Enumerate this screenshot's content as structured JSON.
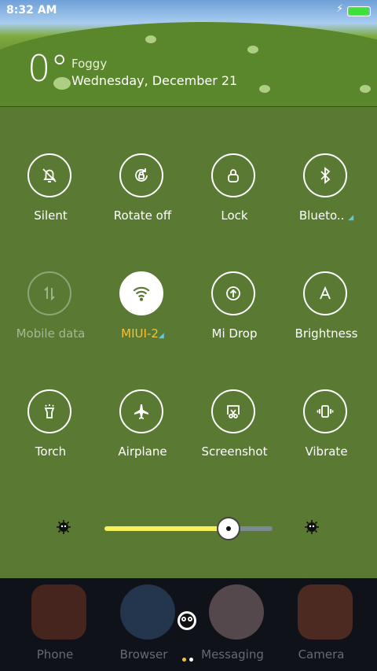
{
  "status_bar": {
    "time": "8:32 AM",
    "charging_icon": "lightning-icon",
    "battery_color": "#3de03d"
  },
  "weather": {
    "temperature": "0°",
    "condition": "Foggy",
    "date": "Wednesday, December 21"
  },
  "toggles": [
    {
      "label": "Silent",
      "icon": "bell-off-icon",
      "state": "off"
    },
    {
      "label": "Rotate off",
      "icon": "rotate-lock-icon",
      "state": "off"
    },
    {
      "label": "Lock",
      "icon": "lock-icon",
      "state": "off"
    },
    {
      "label": "Blueto..",
      "icon": "bluetooth-icon",
      "state": "off",
      "has_more": true
    },
    {
      "label": "Mobile data",
      "icon": "mobile-data-icon",
      "state": "disabled"
    },
    {
      "label": "MIUI-2",
      "icon": "wifi-icon",
      "state": "on",
      "has_more": true
    },
    {
      "label": "Mi Drop",
      "icon": "mi-drop-icon",
      "state": "off"
    },
    {
      "label": "Brightness",
      "icon": "brightness-auto-icon",
      "state": "off"
    },
    {
      "label": "Torch",
      "icon": "torch-icon",
      "state": "off"
    },
    {
      "label": "Airplane",
      "icon": "airplane-icon",
      "state": "off"
    },
    {
      "label": "Screenshot",
      "icon": "screenshot-icon",
      "state": "off"
    },
    {
      "label": "Vibrate",
      "icon": "vibrate-icon",
      "state": "off"
    }
  ],
  "brightness_slider": {
    "level": 0.74,
    "fill_color": "#f6f05a"
  },
  "dock": {
    "apps": [
      "Phone",
      "Browser",
      "Messaging",
      "Camera"
    ]
  },
  "colors": {
    "panel": "#5a7a34",
    "active_label": "#f2c13c",
    "more_indicator": "#5ec8ea"
  }
}
